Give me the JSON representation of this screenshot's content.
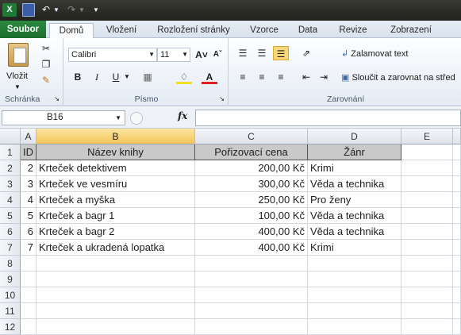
{
  "qat": {
    "undo_icon": "undo-icon",
    "redo_icon": "redo-icon",
    "save_icon": "save-icon",
    "app_icon": "excel-icon"
  },
  "tabs": [
    "Soubor",
    "Domů",
    "Vložení",
    "Rozložení stránky",
    "Vzorce",
    "Data",
    "Revize",
    "Zobrazení"
  ],
  "active_tab": "Domů",
  "ribbon": {
    "clipboard": {
      "paste": "Vložit",
      "label": "Schránka"
    },
    "font": {
      "name": "Calibri",
      "size": "11",
      "bold": "B",
      "italic": "I",
      "underline": "U",
      "label": "Písmo"
    },
    "alignment": {
      "wrap": "Zalamovat text",
      "merge": "Sloučit a zarovnat na střed",
      "label": "Zarovnání"
    }
  },
  "formula_bar": {
    "name_box": "B16",
    "fx": "fx",
    "value": ""
  },
  "columns": [
    "A",
    "B",
    "C",
    "D",
    "E"
  ],
  "selected_column": "B",
  "rows": [
    "1",
    "2",
    "3",
    "4",
    "5",
    "6",
    "7",
    "8",
    "9",
    "10",
    "11",
    "12"
  ],
  "header": {
    "id": "ID",
    "title": "Název knihy",
    "price": "Pořizovací cena",
    "genre": "Žánr"
  },
  "books": [
    {
      "id": "2",
      "title": "Krteček detektivem",
      "price": "200,00 Kč",
      "genre": "Krimi"
    },
    {
      "id": "3",
      "title": "Krteček ve vesmíru",
      "price": "300,00 Kč",
      "genre": "Věda a technika"
    },
    {
      "id": "4",
      "title": "Krteček a myška",
      "price": "250,00 Kč",
      "genre": "Pro ženy"
    },
    {
      "id": "5",
      "title": "Krteček a bagr 1",
      "price": "100,00 Kč",
      "genre": "Věda a technika"
    },
    {
      "id": "6",
      "title": "Krteček a bagr 2",
      "price": "400,00 Kč",
      "genre": "Věda a technika"
    },
    {
      "id": "7",
      "title": "Krteček a ukradená lopatka",
      "price": "400,00 Kč",
      "genre": "Krimi"
    }
  ]
}
